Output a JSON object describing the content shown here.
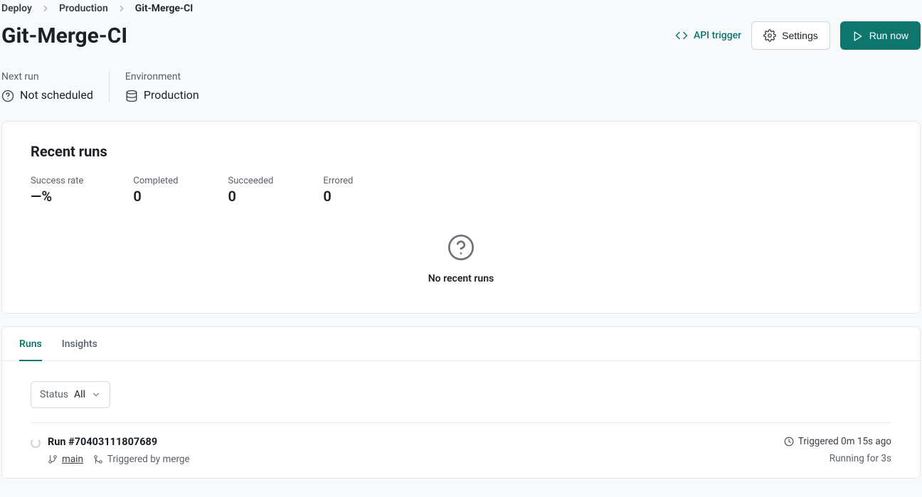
{
  "breadcrumb": {
    "items": [
      {
        "label": "Deploy"
      },
      {
        "label": "Production"
      },
      {
        "label": "Git-Merge-CI"
      }
    ]
  },
  "header": {
    "title": "Git-Merge-CI",
    "api_trigger_label": "API trigger",
    "settings_label": "Settings",
    "run_now_label": "Run now"
  },
  "meta": {
    "next_run_label": "Next run",
    "next_run_value": "Not scheduled",
    "environment_label": "Environment",
    "environment_value": "Production"
  },
  "recent": {
    "title": "Recent runs",
    "stats": {
      "success_rate": {
        "label": "Success rate",
        "value": "—%"
      },
      "completed": {
        "label": "Completed",
        "value": "0"
      },
      "succeeded": {
        "label": "Succeeded",
        "value": "0"
      },
      "errored": {
        "label": "Errored",
        "value": "0"
      }
    },
    "empty_title": "No recent runs"
  },
  "tabs": {
    "runs": "Runs",
    "insights": "Insights"
  },
  "filter": {
    "label": "Status",
    "value": "All"
  },
  "run": {
    "title": "Run #70403111807689",
    "branch": "main",
    "trigger_text": "Triggered by merge",
    "triggered_ago": "Triggered 0m 15s ago",
    "running_for": "Running for 3s"
  }
}
